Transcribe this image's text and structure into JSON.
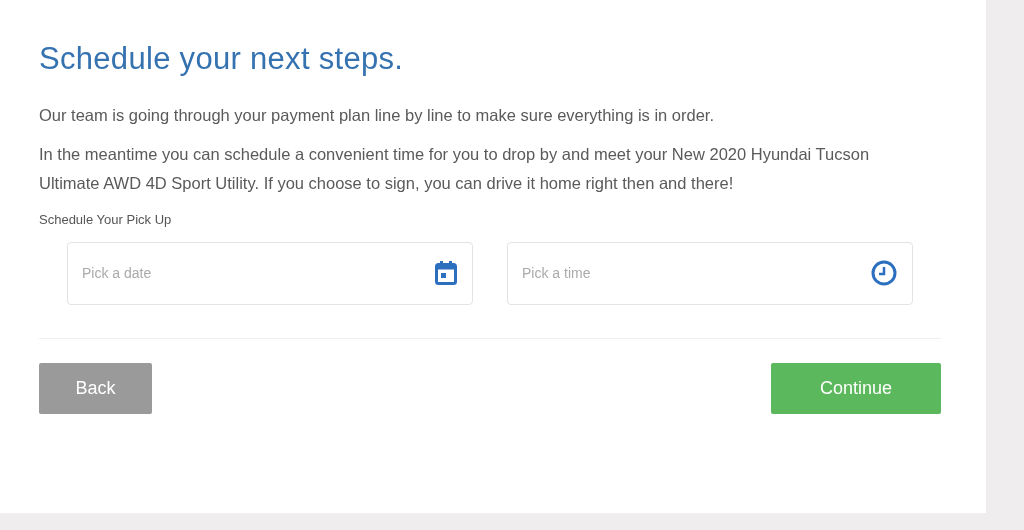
{
  "title": "Schedule your next steps.",
  "paragraphs": [
    "Our team is going through your payment plan line by line to make sure everything is in order.",
    "In the meantime you can schedule a convenient time for you to drop by and meet your New 2020 Hyundai Tucson Ultimate AWD 4D Sport Utility. If you choose to sign, you can drive it home right then and there!"
  ],
  "pickup": {
    "label": "Schedule Your Pick Up",
    "fields": [
      {
        "kind": "date",
        "placeholder": "Pick a date"
      },
      {
        "kind": "time",
        "placeholder": "Pick a time"
      }
    ]
  },
  "buttons": {
    "back": "Back",
    "continue": "Continue"
  }
}
